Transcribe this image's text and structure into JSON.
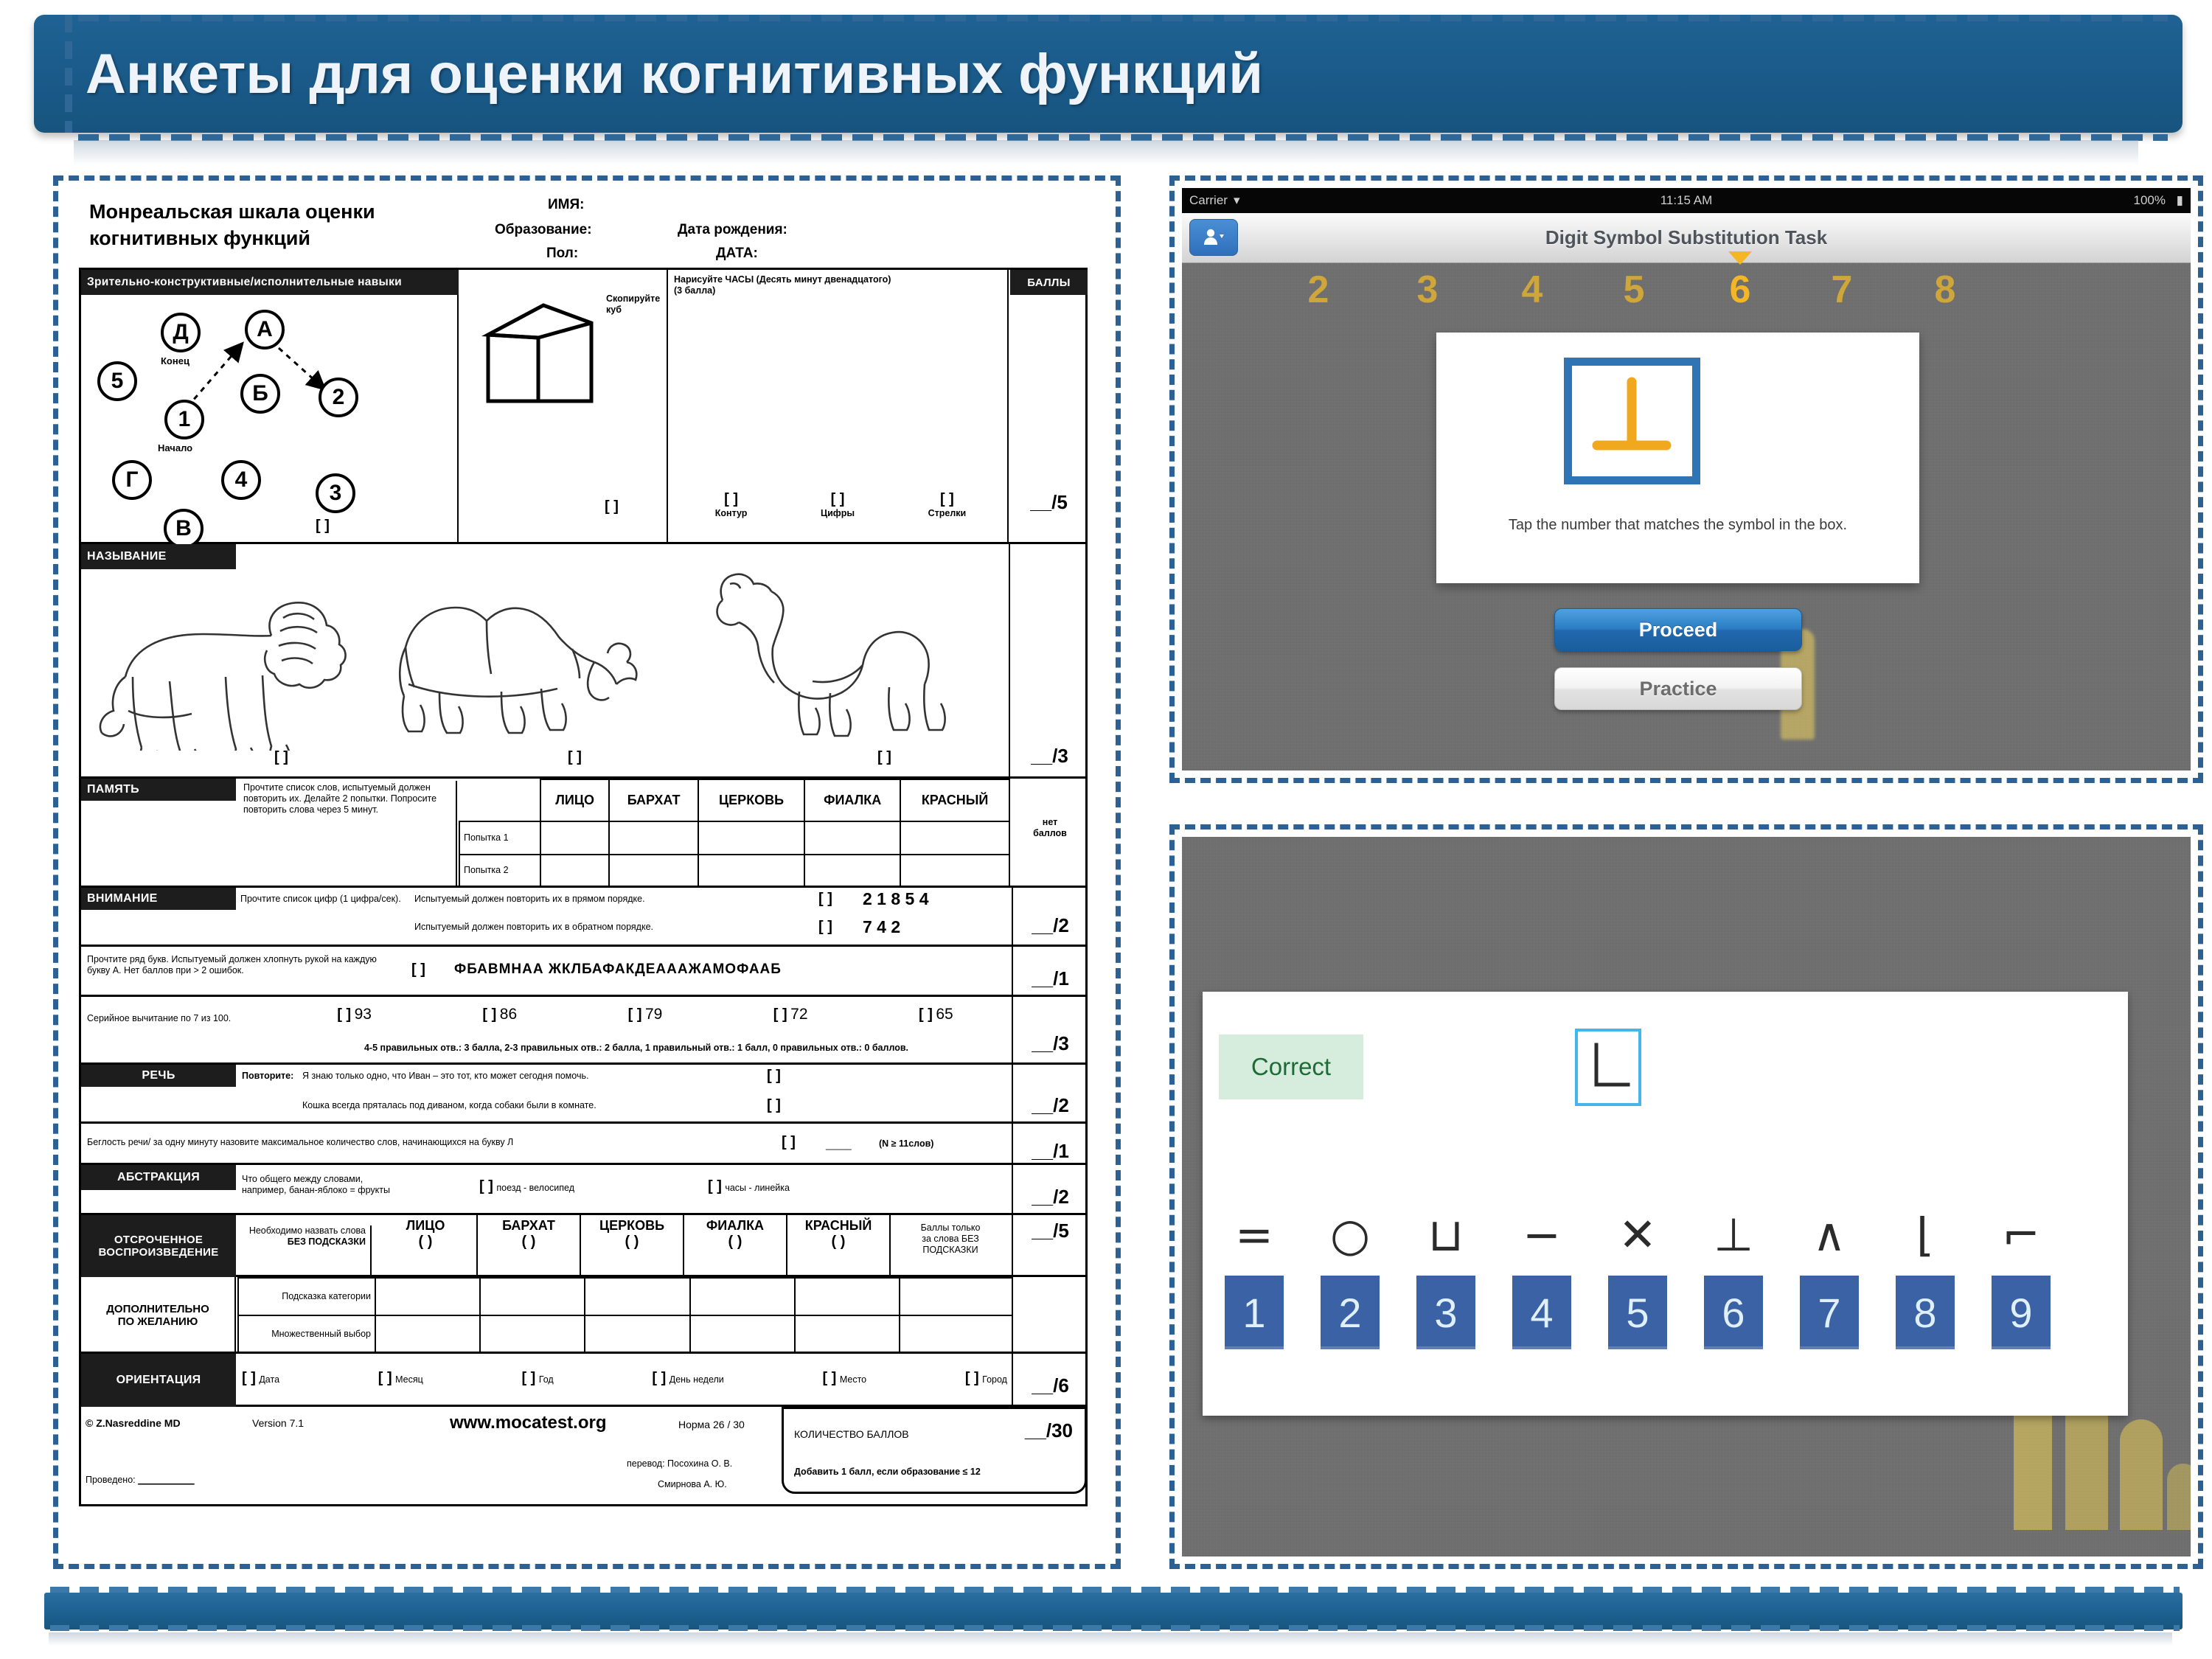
{
  "slide": {
    "title": "Анкеты для оценки когнитивных функций",
    "accent_color": "#1d6293",
    "dash_color": "#2d6193"
  },
  "moca": {
    "title_line1": "Монреальская шкала оценки",
    "title_line2": "когнитивных функций",
    "header_fields": {
      "name": "ИМЯ:",
      "education": "Образование:",
      "dob": "Дата рождения:",
      "sex": "Пол:",
      "date": "ДАТА:"
    },
    "points_col_header": "БАЛЛЫ",
    "visuospatial": {
      "header": "Зрительно-конструктивные/исполнительные навыки",
      "trail_circles": [
        {
          "label": "Д",
          "sub": "Конец"
        },
        {
          "label": "А",
          "sub": ""
        },
        {
          "label": "5",
          "sub": ""
        },
        {
          "label": "Б",
          "sub": ""
        },
        {
          "label": "2",
          "sub": ""
        },
        {
          "label": "1",
          "sub": "Начало"
        },
        {
          "label": "Г",
          "sub": ""
        },
        {
          "label": "4",
          "sub": ""
        },
        {
          "label": "3",
          "sub": ""
        },
        {
          "label": "В",
          "sub": ""
        }
      ],
      "trail_bracket": "[  ]",
      "cube_label_line1": "Скопируйте",
      "cube_label_line2": "куб",
      "cube_bracket": "[  ]",
      "clock_instruction_line1": "Нарисуйте ЧАСЫ (Десять минут двенадцатого)",
      "clock_instruction_line2": "(3 балла)",
      "clock_items": [
        {
          "bracket": "[  ]",
          "label": "Контур"
        },
        {
          "bracket": "[  ]",
          "label": "Цифры"
        },
        {
          "bracket": "[  ]",
          "label": "Стрелки"
        }
      ],
      "score": "__/5"
    },
    "naming": {
      "header": "НАЗЫВАНИЕ",
      "animals": [
        "lion-drawing",
        "rhinoceros-drawing",
        "camel-drawing"
      ],
      "brackets": [
        "[  ]",
        "[  ]",
        "[  ]"
      ],
      "score": "__/3"
    },
    "memory": {
      "header": "ПАМЯТЬ",
      "instruction": "Прочтите список слов, испытуемый должен повторить их. Делайте 2 попытки. Попросите повторить слова через 5 минут.",
      "words": [
        "ЛИЦО",
        "БАРХАТ",
        "ЦЕРКОВЬ",
        "ФИАЛКА",
        "КРАСНЫЙ"
      ],
      "trials": [
        "Попытка 1",
        "Попытка 2"
      ],
      "score_note_line1": "нет",
      "score_note_line2": "баллов"
    },
    "attention": {
      "header": "ВНИМАНИЕ",
      "instruction": "Прочтите список цифр (1 цифра/сек).",
      "forward_label": "Испытуемый должен повторить их в прямом порядке.",
      "forward_bracket": "[  ]",
      "forward_digits": "2 1 8 5 4",
      "backward_label": "Испытуемый должен повторить их в обратном порядке.",
      "backward_bracket": "[  ]",
      "backward_digits": "7 4 2",
      "score_digits": "__/2",
      "letters_instruction_line1": "Прочтите ряд букв. Испытуемый должен хлопнуть рукой на каждую",
      "letters_instruction_line2": "букву А. Нет баллов при > 2 ошибок.",
      "letters_bracket": "[  ]",
      "letters_sequence": "ФБАВМНАА ЖКЛБАФАКДЕАААЖАМОФААБ",
      "score_letters": "__/1",
      "serial7_label": "Серийное вычитание по 7 из 100.",
      "serial7_items": [
        {
          "bracket": "[  ]",
          "value": "93"
        },
        {
          "bracket": "[  ]",
          "value": "86"
        },
        {
          "bracket": "[  ]",
          "value": "79"
        },
        {
          "bracket": "[  ]",
          "value": "72"
        },
        {
          "bracket": "[  ]",
          "value": "65"
        }
      ],
      "serial7_note": "4-5 правильных отв.: 3 балла, 2-3 правильных отв.: 2 балла, 1 правильный отв.: 1 балл, 0 правильных отв.: 0 баллов.",
      "score_serial7": "__/3"
    },
    "language": {
      "header": "РЕЧЬ",
      "repeat_label": "Повторите:",
      "sentence1": "Я знаю только одно, что Иван – это тот, кто может сегодня помочь.",
      "sentence1_bracket": "[  ]",
      "sentence2": "Кошка всегда пряталась под диваном, когда собаки были в комнате.",
      "sentence2_bracket": "[  ]",
      "score_repeat": "__/2",
      "fluency_label": "Беглость речи/ за одну минуту назовите максимальное количество слов, начинающихся на букву Л",
      "fluency_bracket": "[  ]",
      "fluency_blank": "_____",
      "fluency_norm": "(N ≥ 11слов)",
      "score_fluency": "__/1"
    },
    "abstraction": {
      "header": "АБСТРАКЦИЯ",
      "instruction_line1": "Что общего между словами,",
      "instruction_line2": "например, банан-яблоко = фрукты",
      "items": [
        {
          "bracket": "[  ]",
          "text": "поезд  -  велосипед"
        },
        {
          "bracket": "[  ]",
          "text": "часы  -  линейка"
        }
      ],
      "score": "__/2"
    },
    "delayed_recall": {
      "header_line1": "ОТСРОЧЕННОЕ",
      "header_line2": "ВОСПРОИЗВЕДЕНИЕ",
      "instruction_line1": "Необходимо назвать слова",
      "instruction_line2": "БЕЗ ПОДСКАЗКИ",
      "words": [
        "ЛИЦО",
        "БАРХАТ",
        "ЦЕРКОВЬ",
        "ФИАЛКА",
        "КРАСНЫЙ"
      ],
      "brackets": [
        "(  )",
        "(  )",
        "(  )",
        "(  )",
        "(  )"
      ],
      "note_line1": "Баллы только",
      "note_line2": "за слова БЕЗ",
      "note_line3": "ПОДСКАЗКИ",
      "score": "__/5",
      "optional_header_line1": "ДОПОЛНИТЕЛЬНО",
      "optional_header_line2": "ПО ЖЕЛАНИЮ",
      "optional_rows": [
        "Подсказка категории",
        "Множественный выбор"
      ]
    },
    "orientation": {
      "header": "ОРИЕНТАЦИЯ",
      "items": [
        {
          "bracket": "[  ]",
          "label": "Дата"
        },
        {
          "bracket": "[  ]",
          "label": "Месяц"
        },
        {
          "bracket": "[  ]",
          "label": "Год"
        },
        {
          "bracket": "[  ]",
          "label": "День недели"
        },
        {
          "bracket": "[  ]",
          "label": "Место"
        },
        {
          "bracket": "[  ]",
          "label": "Город"
        }
      ],
      "score": "__/6"
    },
    "footer": {
      "copyright": "© Z.Nasreddine MD",
      "version": "Version 7.1",
      "website": "www.mocatest.org",
      "norm": "Норма  26 / 30",
      "translation_line1": "перевод: Посохина О. В.",
      "translation_line2": "Смирнова А. Ю.",
      "total_label": "КОЛИЧЕСТВО БАЛЛОВ",
      "total_score": "__/30",
      "total_note": "Добавить 1 балл, если образование ≤ 12",
      "conducted_label": "Проведено:",
      "conducted_blank": "___________"
    }
  },
  "dsst_task": {
    "status_bar": {
      "carrier": "Carrier",
      "wifi_icon": "wifi-icon",
      "time": "11:15 AM",
      "battery": "100%"
    },
    "nav_title": "Digit Symbol Substitution Task",
    "contacts_icon": "contacts-icon",
    "digit_strip": [
      "2",
      "3",
      "4",
      "5",
      "6",
      "7",
      "8"
    ],
    "active_digit": "6",
    "card_symbol": "perpendicular-symbol",
    "prompt": "Tap the number that matches the symbol in the box.",
    "buttons": {
      "proceed": "Proceed",
      "practice": "Practice"
    }
  },
  "dsst_response": {
    "feedback": "Correct",
    "feedback_color": "#1f6b38",
    "target_symbol": "corner-L-symbol",
    "symbols": [
      "=",
      "○",
      "⊔",
      "−",
      "✕",
      "⊥",
      "∧",
      "⌊",
      "⌐"
    ],
    "numbers": [
      "1",
      "2",
      "3",
      "4",
      "5",
      "6",
      "7",
      "8",
      "9"
    ]
  }
}
